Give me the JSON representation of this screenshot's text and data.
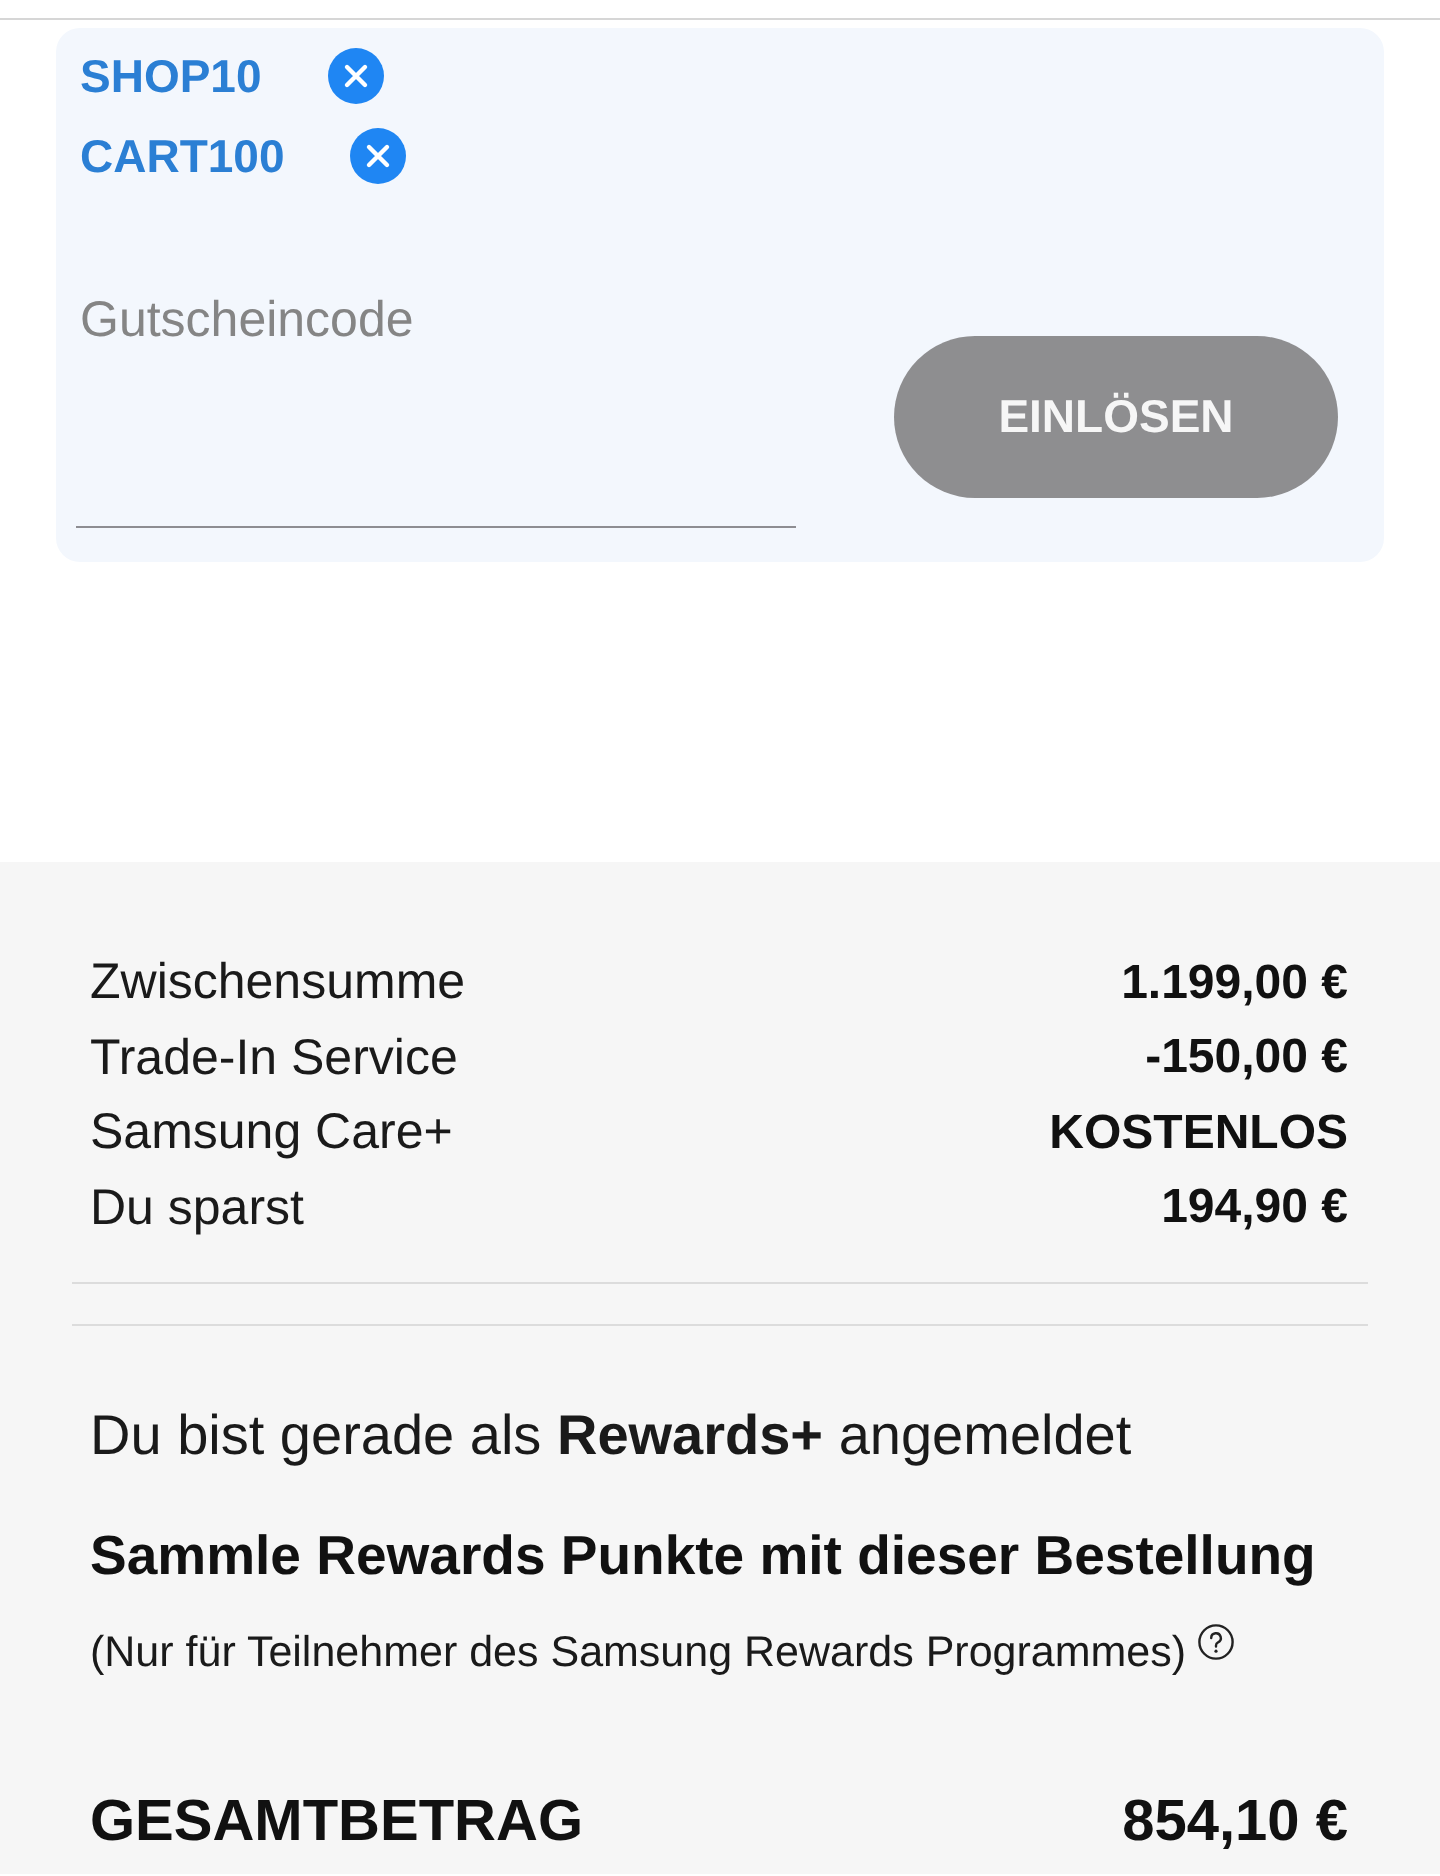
{
  "coupon_panel": {
    "applied_codes": [
      {
        "code": "SHOP10"
      },
      {
        "code": "CART100"
      }
    ],
    "code_field": {
      "placeholder": "Gutscheincode"
    },
    "redeem_button": {
      "label": "EINLÖSEN",
      "disabled": true
    }
  },
  "summary": {
    "rows": [
      {
        "label": "Zwischensumme",
        "value": "1.199,00 €"
      },
      {
        "label": "Trade-In Service",
        "value": "-150,00 €"
      },
      {
        "label": "Samsung Care+",
        "value": "KOSTENLOS"
      },
      {
        "label": "Du sparst",
        "value": "194,90 €"
      }
    ],
    "rewards_status": "Du bist gerade als **Rewards+** angemeldet",
    "rewards_heading": "Sammle Rewards Punkte mit dieser Bestellung",
    "rewards_note": "(Nur für Teilnehmer des Samsung Rewards Programmes)",
    "total": {
      "label": "GESAMTBETRAG",
      "value": "854,10 €"
    }
  }
}
